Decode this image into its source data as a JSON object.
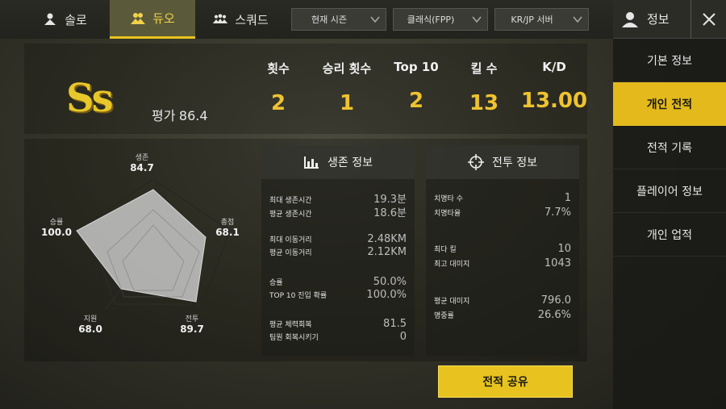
{
  "tabs": [
    {
      "label": "솔로",
      "icon": "solo-icon",
      "active": false
    },
    {
      "label": "듀오",
      "icon": "duo-icon",
      "active": true
    },
    {
      "label": "스쿼드",
      "icon": "squad-icon",
      "active": false
    }
  ],
  "filters": {
    "season": "현재 시즌",
    "mode": "클래식(FPP)",
    "server": "KR/JP 서버"
  },
  "sidebar": {
    "title": "정보",
    "items": [
      {
        "label": "기본 정보",
        "active": false
      },
      {
        "label": "개인 전적",
        "active": true
      },
      {
        "label": "전적 기록",
        "active": false
      },
      {
        "label": "플레이어 정보",
        "active": false
      },
      {
        "label": "개인 업적",
        "active": false
      }
    ]
  },
  "grade": {
    "tier": "Ss",
    "rating_label": "평가",
    "rating_value": "86.4"
  },
  "summary": [
    {
      "label": "횟수",
      "value": "2"
    },
    {
      "label": "승리 횟수",
      "value": "1"
    },
    {
      "label": "Top 10",
      "value": "2"
    },
    {
      "label": "킬 수",
      "value": "13"
    },
    {
      "label": "K/D",
      "value": "13.00"
    }
  ],
  "radar": {
    "survival": {
      "label": "생존",
      "value": "84.7"
    },
    "kills": {
      "label": "총점",
      "value": "68.1"
    },
    "combat": {
      "label": "전투",
      "value": "89.7"
    },
    "support": {
      "label": "지원",
      "value": "68.0"
    },
    "win": {
      "label": "승률",
      "value": "100.0"
    }
  },
  "survival_panel": {
    "title": "생존 정보",
    "rows": [
      {
        "k": "최대 생존시간",
        "v": "19.3분"
      },
      {
        "k": "평균 생존시간",
        "v": "18.6분"
      },
      {
        "k": "최대 이동거리",
        "v": "2.48KM"
      },
      {
        "k": "평균 이동거리",
        "v": "2.12KM"
      },
      {
        "k": "승률",
        "v": "50.0%"
      },
      {
        "k": "TOP 10 진입 확률",
        "v": "100.0%"
      },
      {
        "k": "평균 체력회복",
        "v": "81.5"
      },
      {
        "k": "팀원 회복시키기",
        "v": "0"
      }
    ]
  },
  "combat_panel": {
    "title": "전투 정보",
    "rows": [
      {
        "k": "치명타 수",
        "v": "1"
      },
      {
        "k": "치명타율",
        "v": "7.7%"
      },
      {
        "k": "최다 킬",
        "v": "10"
      },
      {
        "k": "최고 대미지",
        "v": "1043"
      },
      {
        "k": "평균 대미지",
        "v": "796.0"
      },
      {
        "k": "명중률",
        "v": "26.6%"
      }
    ]
  },
  "share_label": "전적 공유",
  "colors": {
    "accent": "#e8c31f",
    "value": "#eec330"
  }
}
